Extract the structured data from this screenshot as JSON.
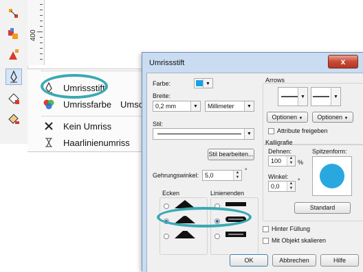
{
  "ruler": {
    "label": "400"
  },
  "flyout": {
    "items": [
      {
        "label": "Umrissstift",
        "icon": "pen-nib-icon"
      },
      {
        "label": "Umrissfarbe",
        "label2": "Umscha",
        "icon": "color-wheel-icon"
      },
      {
        "label": "Kein Umriss",
        "icon": "no-outline-x-icon"
      },
      {
        "label": "Haarlinienumriss",
        "icon": "hairline-icon"
      }
    ]
  },
  "dialog": {
    "title": "Umrissstift",
    "close_label": "x",
    "farbe_label": "Farbe:",
    "farbe_color": "#1aa0e8",
    "breite_label": "Breite:",
    "breite_value": "0,2 mm",
    "unit_value": "Millimeter",
    "stil_label": "Stil:",
    "stil_edit_button": "Stil bearbeiten...",
    "gehrung_label": "Gehrungswinkel:",
    "gehrung_value": "5,0",
    "degree": "°",
    "ecken_label": "Ecken",
    "linienenden_label": "Linienenden",
    "arrows_label": "Arrows",
    "optionen_left": "Optionen",
    "optionen_right": "Optionen",
    "attribute_label": "Attribute freigeben",
    "kalligrafie_label": "Kalligrafie",
    "dehnen_label": "Dehnen:",
    "dehnen_value": "100",
    "percent": "%",
    "spitzenform_label": "Spitzenform:",
    "winkel_label": "Winkel:",
    "winkel_value": "0,0",
    "standard_button": "Standard",
    "hinter_fuellung_label": "Hinter Füllung",
    "mit_objekt_label": "Mit Objekt skalieren",
    "ok_button": "OK",
    "abbrechen_button": "Abbrechen",
    "hilfe_button": "Hilfe",
    "nib_color": "#29a8e0"
  },
  "colors": {
    "highlight": "#3aa9b3",
    "title_bar": "#c9dcf1"
  }
}
